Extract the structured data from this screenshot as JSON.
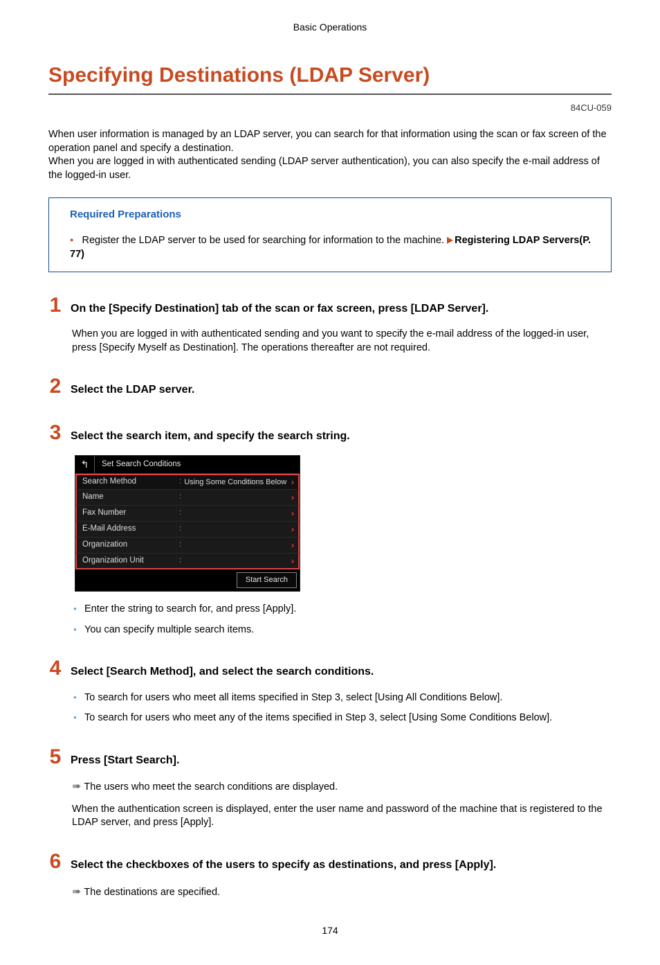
{
  "breadcrumb": "Basic Operations",
  "title": "Specifying Destinations (LDAP Server)",
  "doc_code": "84CU-059",
  "intro": [
    "When user information is managed by an LDAP server, you can search for that information using the scan or fax screen of the operation panel and specify a destination.",
    "When you are logged in with authenticated sending (LDAP server authentication), you can also specify the e-mail address of the logged-in user."
  ],
  "prep": {
    "heading": "Required Preparations",
    "item_prefix": "Register the LDAP server to be used for searching for information to the machine. ",
    "link_text": "Registering LDAP Servers(P. 77)"
  },
  "steps": [
    {
      "num": "1",
      "title": "On the [Specify Destination] tab of the scan or fax screen, press [LDAP Server].",
      "body_paragraphs": [
        "When you are logged in with authenticated sending and you want to specify the e-mail address of the logged-in user, press [Specify Myself as Destination]. The operations thereafter are not required."
      ]
    },
    {
      "num": "2",
      "title": "Select the LDAP server."
    },
    {
      "num": "3",
      "title": "Select the search item, and specify the search string.",
      "has_panel": true,
      "bullets": [
        "Enter the string to search for, and press [Apply].",
        "You can specify multiple search items."
      ]
    },
    {
      "num": "4",
      "title": "Select [Search Method], and select the search conditions.",
      "bullets": [
        "To search for users who meet all items specified in Step 3, select [Using All Conditions Below].",
        "To search for users who meet any of the items specified in Step 3, select [Using Some Conditions Below]."
      ]
    },
    {
      "num": "5",
      "title": "Press [Start Search].",
      "result": "The users who meet the search conditions are displayed.",
      "body_paragraphs": [
        "When the authentication screen is displayed, enter the user name and password of the machine that is registered to the LDAP server, and press [Apply]."
      ]
    },
    {
      "num": "6",
      "title": "Select the checkboxes of the users to specify as destinations, and press [Apply].",
      "result": "The destinations are specified."
    }
  ],
  "panel": {
    "title": "Set Search Conditions",
    "method_label": "Search Method",
    "method_value": "Using Some Conditions Below",
    "fields": [
      "Name",
      "Fax Number",
      "E-Mail Address",
      "Organization",
      "Organization Unit"
    ],
    "button": "Start Search"
  },
  "page_number": "174"
}
